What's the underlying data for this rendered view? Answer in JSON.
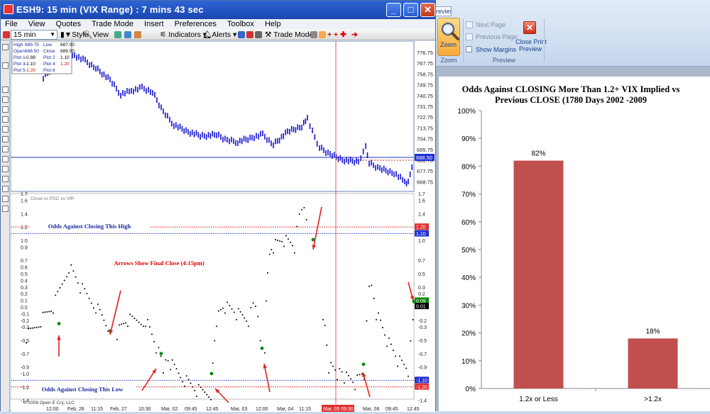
{
  "window": {
    "title": "ESH9: 15 min (VIX Range) : 7 mins 43 sec",
    "minimize": "_",
    "maximize": "□",
    "close": "✕"
  },
  "menu": [
    "File",
    "View",
    "Quotes",
    "Trade Mode",
    "Insert",
    "Preferences",
    "Toolbox",
    "Help"
  ],
  "toolbar": {
    "interval": "15 min",
    "style": "Style",
    "view": "View",
    "indicators": "Indicators",
    "alerts": "Alerts",
    "trade_mode": "Trade Mode"
  },
  "data_box": {
    "rows": [
      [
        "High",
        "689.75",
        "Low",
        "687.00"
      ],
      [
        "Open",
        "688.50",
        "Close",
        "689.50"
      ],
      [
        "Plot 1",
        "-0.88",
        "Plot 2",
        "1.10"
      ],
      [
        "Plot 3",
        "-1.10",
        "Plot 4",
        "1.20"
      ],
      [
        "Plot 5",
        "-1.20",
        "Plot 6",
        ""
      ]
    ]
  },
  "price_panel": {
    "ticks": [
      "776.75",
      "767.75",
      "758.75",
      "749.75",
      "740.75",
      "731.75",
      "722.75",
      "713.75",
      "704.75",
      "695.75",
      "686.75",
      "677.75",
      "668.75"
    ],
    "last_price": "688.50",
    "last_price_color": "#1f2fd6",
    "bar_color": "#1010d0"
  },
  "indicator_panel": {
    "label": "Close vs PDC vs VIR",
    "ticks": [
      "1.7",
      "1.6",
      "1.4",
      "1.2",
      "1.0",
      "0.9",
      "0.7",
      "0.6",
      "0.5",
      "0.4",
      "0.3",
      "0.2",
      "0.1",
      "0.0",
      "-0.1",
      "-0.2",
      "-0.3",
      "-0.5",
      "-0.7",
      "-0.9",
      "-1.0",
      "-1.2",
      "-1.4"
    ],
    "right_ticks": [
      "1.7",
      "1.6",
      "1.4",
      "1.0",
      "0.7",
      "0.5",
      "0.3",
      "0.2",
      "0.0",
      "-0.2",
      "-0.3",
      "-0.5",
      "-0.7",
      "-0.9",
      "-1.2",
      "-1.4"
    ],
    "badges": {
      "upper_red": "1.20",
      "upper_blue": "1.10",
      "green": "0.09",
      "black": "0.01",
      "lower_blue": "-1.10",
      "lower_red": "-1.20"
    },
    "annotations": {
      "top": "Odds Against Closing This High",
      "middle": "Arrows Show Final Close (4:15pm)",
      "bottom": "Odds Against Closing This Low"
    },
    "copyright": "© 2009 Open E Cry, LLC"
  },
  "time_axis": [
    "12:00",
    "Feb, 26",
    "11:15",
    "Feb, 27",
    "10:30",
    "Mar, 02",
    "09:45",
    "12:45",
    "Mar, 03",
    "12:00",
    "Mar, 04",
    "11:15",
    "Mar, 05 09:30",
    "Mar, 06",
    "09:45",
    "12:45"
  ],
  "preview": {
    "tab": "review",
    "zoom": "Zoom",
    "zoom_group": "Zoom",
    "next_page": "Next Page",
    "previous_page": "Previous Page",
    "show_margins": "Show Margins",
    "close_print_preview": [
      "Close Print",
      "Preview"
    ],
    "preview_group": "Preview"
  },
  "chart_data": {
    "type": "bar",
    "title": "Odds Against CLOSING More Than 1.2+ VIX Implied vs Previous CLOSE (1780 Days 2002 -2009",
    "title_lines": [
      "Odds Against CLOSING More Than 1.2+ VIX Implied vs",
      "Previous CLOSE (1780 Days 2002 -2009"
    ],
    "categories": [
      "1.2x or Less",
      ">1.2x"
    ],
    "values": [
      82,
      18
    ],
    "data_labels": [
      "82%",
      "18%"
    ],
    "ylim": [
      0,
      100
    ],
    "yticks": [
      "0%",
      "10%",
      "20%",
      "30%",
      "40%",
      "50%",
      "60%",
      "70%",
      "80%",
      "90%",
      "100%"
    ],
    "bar_color": "#c0504d",
    "legend": "none"
  }
}
